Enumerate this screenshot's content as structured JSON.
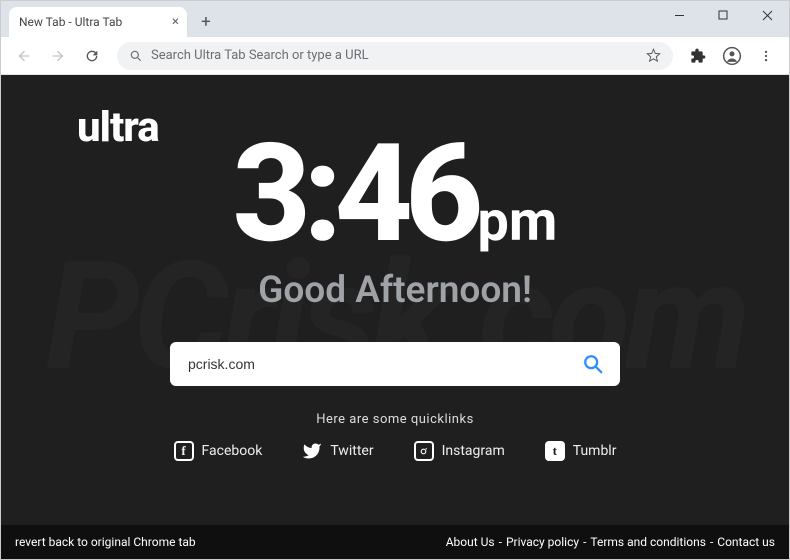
{
  "window": {
    "tab_title": "New Tab - Ultra Tab"
  },
  "omnibox": {
    "placeholder": "Search Ultra Tab Search or type a URL"
  },
  "page": {
    "logo": "ultra",
    "clock_time": "3:46",
    "clock_ampm": "pm",
    "greeting": "Good Afternoon!",
    "search_value": "pcrisk.com",
    "quicklinks_heading": "Here are some quicklinks",
    "watermark": "PCrisk.com"
  },
  "quicklinks": [
    {
      "label": "Facebook",
      "glyph": "f"
    },
    {
      "label": "Twitter",
      "glyph": ""
    },
    {
      "label": "Instagram",
      "glyph": ""
    },
    {
      "label": "Tumblr",
      "glyph": "t"
    }
  ],
  "footer": {
    "revert": "revert back to original Chrome tab",
    "links": [
      "About Us",
      "Privacy policy",
      "Terms and conditions",
      "Contact us"
    ]
  }
}
